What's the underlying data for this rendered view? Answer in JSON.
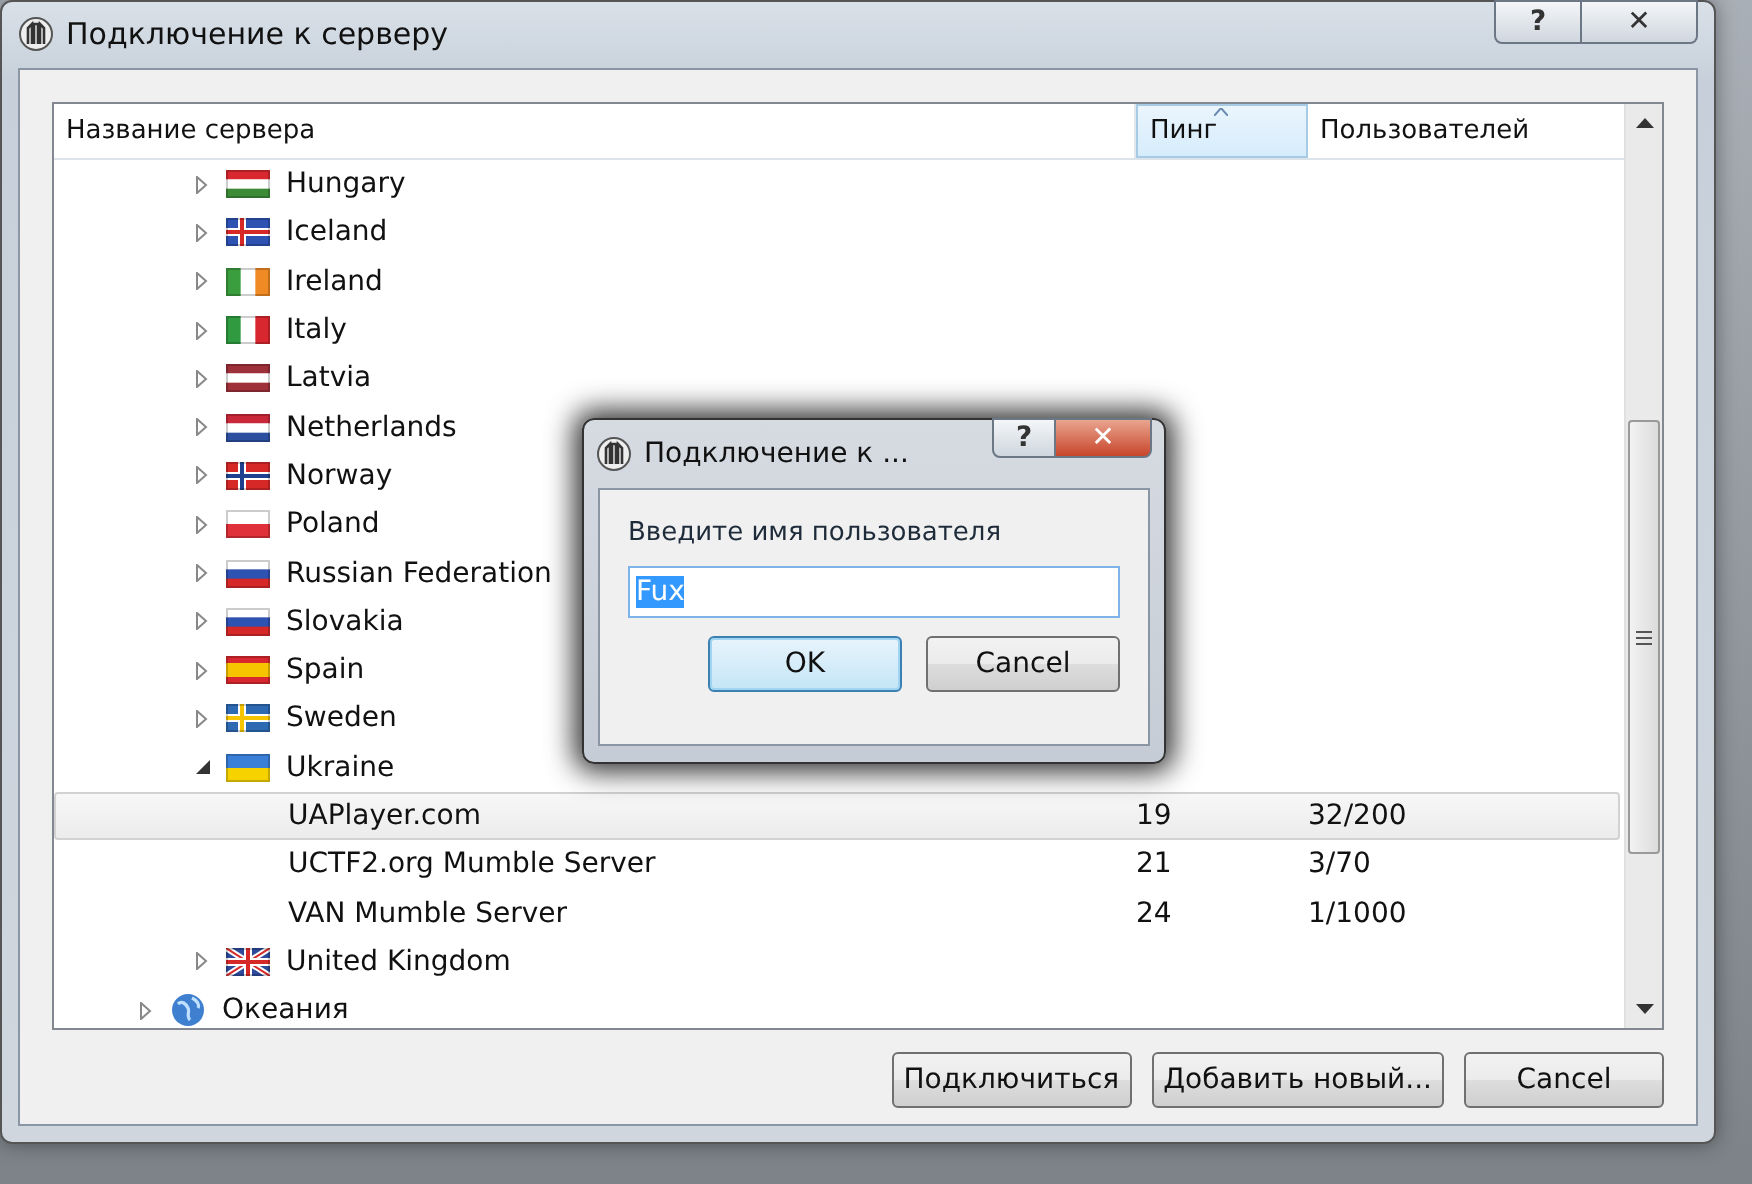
{
  "window": {
    "title": "Подключение к серверу",
    "help": "?",
    "close": "✕"
  },
  "columns": [
    {
      "label": "Название сервера",
      "sorted": false
    },
    {
      "label": "Пинг",
      "sorted": true
    },
    {
      "label": "Пользователей",
      "sorted": false
    }
  ],
  "tree": [
    {
      "children": [
        {
          "label": "Hungary",
          "expanded": false,
          "kind": "hungary"
        },
        {
          "label": "Iceland",
          "expanded": false,
          "kind": "iceland"
        },
        {
          "label": "Ireland",
          "expanded": false,
          "kind": "ireland"
        },
        {
          "label": "Italy",
          "expanded": false,
          "kind": "italy"
        },
        {
          "label": "Latvia",
          "expanded": false,
          "kind": "latvia"
        },
        {
          "label": "Netherlands",
          "expanded": false,
          "kind": "netherlands"
        },
        {
          "label": "Norway",
          "expanded": false,
          "kind": "norway"
        },
        {
          "label": "Poland",
          "expanded": false,
          "kind": "poland"
        },
        {
          "label": "Russian Federation",
          "expanded": false,
          "kind": "russia"
        },
        {
          "label": "Slovakia",
          "expanded": false,
          "kind": "slovakia"
        },
        {
          "label": "Spain",
          "expanded": false,
          "kind": "spain"
        },
        {
          "label": "Sweden",
          "expanded": false,
          "kind": "sweden"
        },
        {
          "label": "Ukraine",
          "expanded": true,
          "kind": "ukraine",
          "servers": [
            {
              "name": "UAPlayer.com",
              "ping": "19",
              "users": "32/200",
              "selected": true
            },
            {
              "name": "UCTF2.org Mumble Server",
              "ping": "21",
              "users": "3/70",
              "selected": false
            },
            {
              "name": "VAN Mumble Server",
              "ping": "24",
              "users": "1/1000",
              "selected": false
            }
          ]
        },
        {
          "label": "United Kingdom",
          "expanded": false,
          "kind": "uk"
        }
      ]
    },
    {
      "label": "Океания",
      "expanded": false,
      "kind": "globe"
    }
  ],
  "buttons": [
    {
      "label": "Подключиться",
      "default": false
    },
    {
      "label": "Добавить новый...",
      "default": false
    },
    {
      "label": "Cancel",
      "default": false
    }
  ],
  "dialog": {
    "title": "Подключение к ...",
    "help": "?",
    "close": "✕",
    "prompt": "Введите имя пользователя",
    "value": "Fux",
    "value_selected": true,
    "buttons": [
      {
        "label": "OK",
        "default": true
      },
      {
        "label": "Cancel",
        "default": false
      }
    ]
  }
}
